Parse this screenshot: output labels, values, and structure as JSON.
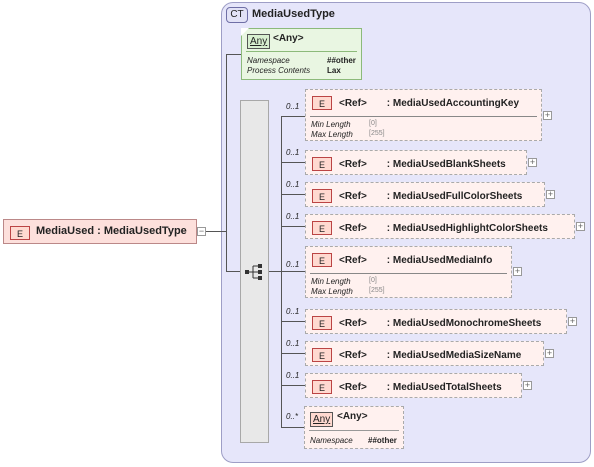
{
  "complex_type": {
    "badge": "CT",
    "name": "MediaUsedType"
  },
  "any_top": {
    "badge": "Any",
    "label": "<Any>",
    "props": [
      {
        "key": "Namespace",
        "value": "##other"
      },
      {
        "key": "Process Contents",
        "value": "Lax"
      }
    ]
  },
  "root": {
    "badge": "E",
    "label": "MediaUsed : MediaUsedType"
  },
  "elements": [
    {
      "occurs": "0..1",
      "badge": "E",
      "ref": "<Ref>",
      "name": ": MediaUsedAccountingKey",
      "props": [
        {
          "key": "Min Length",
          "value": "[0]"
        },
        {
          "key": "Max Length",
          "value": "[255]"
        }
      ]
    },
    {
      "occurs": "0..1",
      "badge": "E",
      "ref": "<Ref>",
      "name": ": MediaUsedBlankSheets"
    },
    {
      "occurs": "0..1",
      "badge": "E",
      "ref": "<Ref>",
      "name": ": MediaUsedFullColorSheets"
    },
    {
      "occurs": "0..1",
      "badge": "E",
      "ref": "<Ref>",
      "name": ": MediaUsedHighlightColorSheets"
    },
    {
      "occurs": "0..1",
      "badge": "E",
      "ref": "<Ref>",
      "name": ": MediaUsedMediaInfo",
      "props": [
        {
          "key": "Min Length",
          "value": "[0]"
        },
        {
          "key": "Max Length",
          "value": "[255]"
        }
      ]
    },
    {
      "occurs": "0..1",
      "badge": "E",
      "ref": "<Ref>",
      "name": ": MediaUsedMonochromeSheets"
    },
    {
      "occurs": "0..1",
      "badge": "E",
      "ref": "<Ref>",
      "name": ": MediaUsedMediaSizeName"
    },
    {
      "occurs": "0..1",
      "badge": "E",
      "ref": "<Ref>",
      "name": ": MediaUsedTotalSheets"
    }
  ],
  "any_bottom": {
    "occurs": "0..*",
    "badge": "Any",
    "label": "<Any>",
    "props": [
      {
        "key": "Namespace",
        "value": "##other"
      }
    ]
  },
  "expand_symbol": "+",
  "collapse_symbol": "−"
}
